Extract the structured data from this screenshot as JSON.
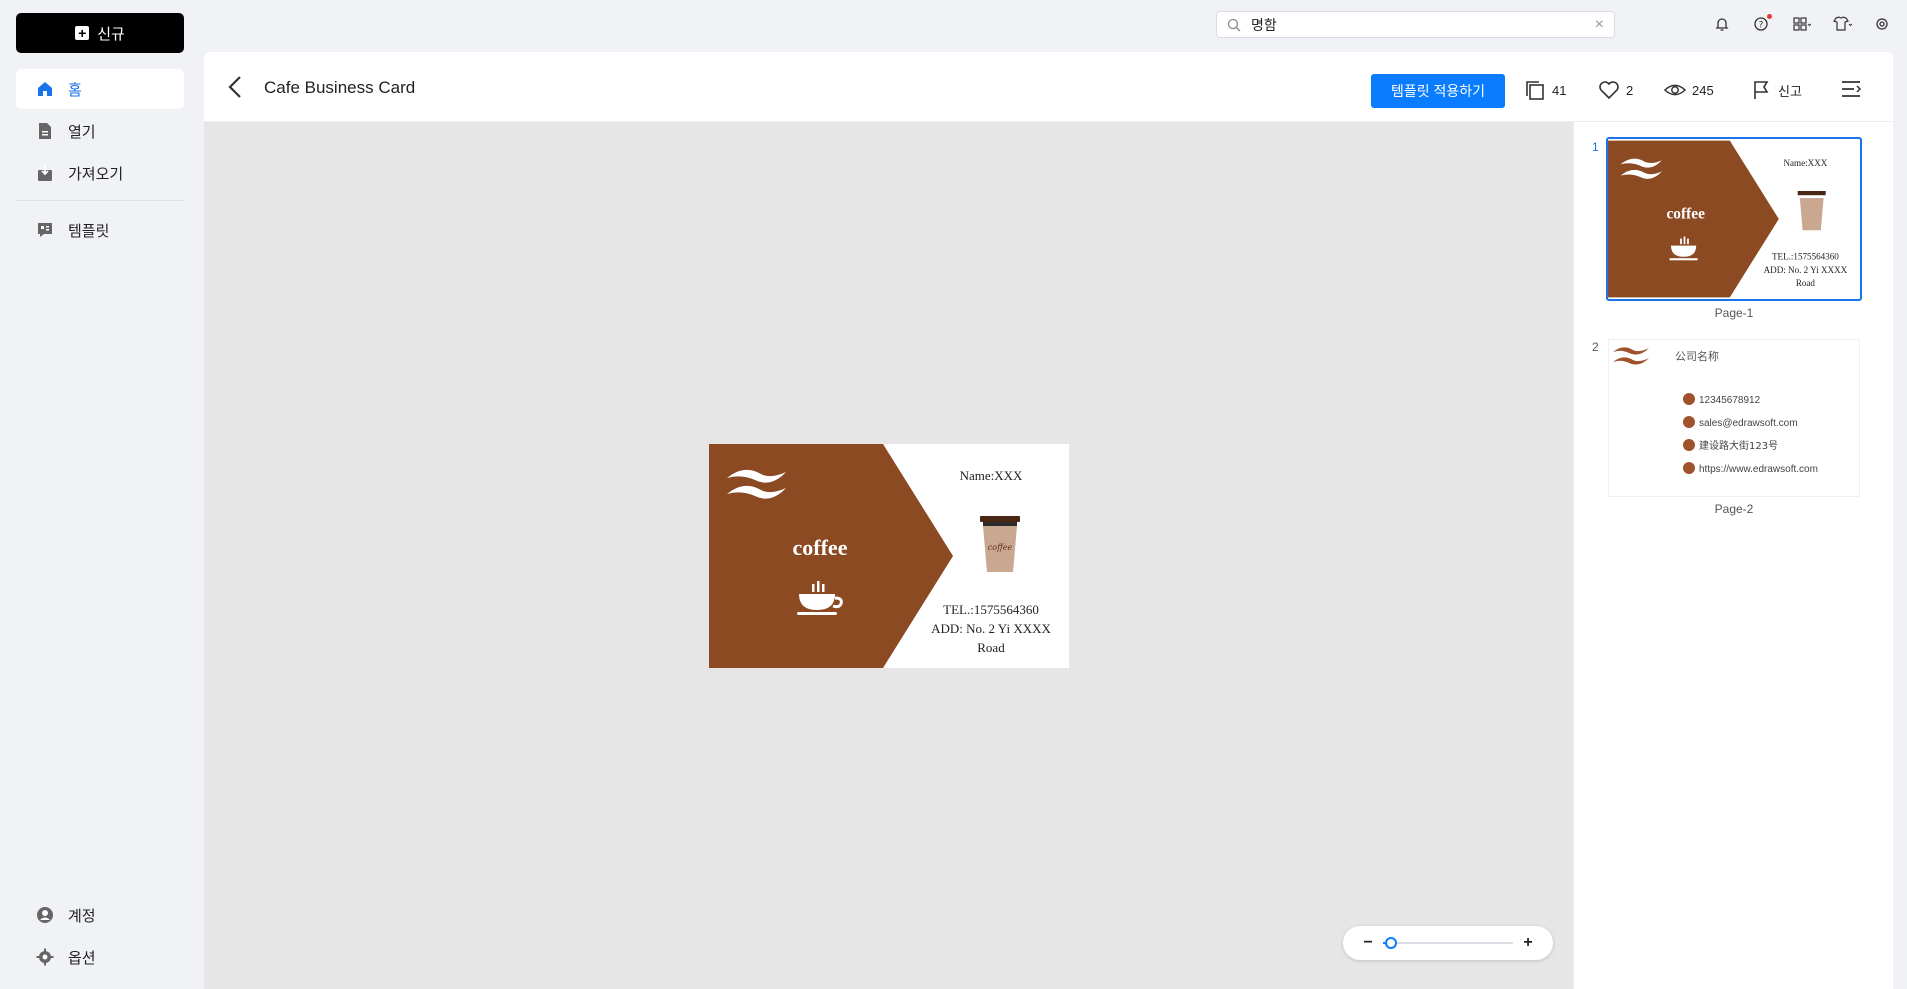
{
  "sidebar": {
    "new_label": "신규",
    "items": [
      {
        "label": "홈",
        "icon": "home-icon"
      },
      {
        "label": "열기",
        "icon": "file-icon"
      },
      {
        "label": "가져오기",
        "icon": "import-icon"
      },
      {
        "label": "템플릿",
        "icon": "template-icon"
      }
    ],
    "bottom": [
      {
        "label": "계정",
        "icon": "account-icon"
      },
      {
        "label": "옵션",
        "icon": "gear-icon"
      }
    ]
  },
  "search": {
    "value": "명함"
  },
  "header": {
    "title": "Cafe Business Card",
    "apply_label": "템플릿 적용하기",
    "copies": "41",
    "likes": "2",
    "views": "245",
    "report_label": "신고"
  },
  "card": {
    "brand": "coffee",
    "name": "Name:XXX",
    "cup_text": "coffee",
    "tel": "TEL.:1575564360",
    "address_line1": "ADD: No. 2 Yi XXXX",
    "address_line2": "Road"
  },
  "page2": {
    "company": "公司名称",
    "phone": "12345678912",
    "email": "sales@edrawsoft.com",
    "address": "建设路大街123号",
    "website": "https://www.edrawsoft.com"
  },
  "pages": [
    {
      "number": "1",
      "label": "Page-1"
    },
    {
      "number": "2",
      "label": "Page-2"
    }
  ],
  "zoom": {
    "level": 0.06
  },
  "colors": {
    "accent": "#0a7cff",
    "brown": "#8b4a22"
  }
}
